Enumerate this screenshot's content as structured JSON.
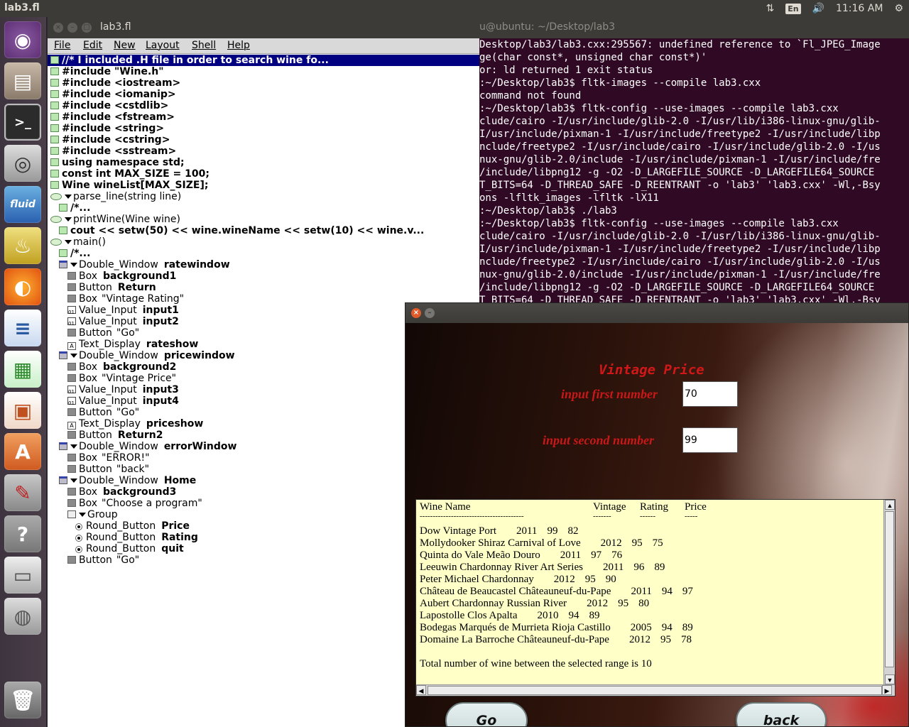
{
  "top_panel": {
    "title": "lab3.fl",
    "keyboard": "En",
    "time": "11:16 AM"
  },
  "launcher": {
    "items": [
      "ubuntu-dash",
      "files",
      "terminal",
      "camera",
      "fluid",
      "lamp",
      "firefox",
      "writer",
      "calc",
      "impress",
      "software-center",
      "settings",
      "help",
      "drive",
      "disk",
      "trash"
    ]
  },
  "fluid_window": {
    "title": "lab3.fl",
    "menu": [
      "File",
      "Edit",
      "New",
      "Layout",
      "Shell",
      "Help"
    ],
    "tree": [
      {
        "type": "code",
        "indent": 0,
        "text": "//* I included .H file in order to search wine fo...",
        "selected": true
      },
      {
        "type": "code",
        "indent": 0,
        "text": "#include \"Wine.h\""
      },
      {
        "type": "code",
        "indent": 0,
        "text": "#include <iostream>"
      },
      {
        "type": "code",
        "indent": 0,
        "text": "#include <iomanip>"
      },
      {
        "type": "code",
        "indent": 0,
        "text": "#include <cstdlib>"
      },
      {
        "type": "code",
        "indent": 0,
        "text": "#include <fstream>"
      },
      {
        "type": "code",
        "indent": 0,
        "text": "#include <string>"
      },
      {
        "type": "code",
        "indent": 0,
        "text": "#include <cstring>"
      },
      {
        "type": "code",
        "indent": 0,
        "text": "#include <sstream>"
      },
      {
        "type": "code",
        "indent": 0,
        "text": "using namespace std;"
      },
      {
        "type": "code",
        "indent": 0,
        "text": "const int MAX_SIZE = 100;"
      },
      {
        "type": "code",
        "indent": 0,
        "text": "Wine wineList[MAX_SIZE];"
      },
      {
        "type": "func",
        "indent": 0,
        "text": "parse_line(string line)"
      },
      {
        "type": "code",
        "indent": 1,
        "text": "/*..."
      },
      {
        "type": "func",
        "indent": 0,
        "text": "printWine(Wine wine)"
      },
      {
        "type": "code",
        "indent": 1,
        "text": "cout << setw(50) << wine.wineName << setw(10) << wine.v..."
      },
      {
        "type": "func",
        "indent": 0,
        "text": "main()"
      },
      {
        "type": "code",
        "indent": 1,
        "text": "/*..."
      },
      {
        "type": "win",
        "indent": 1,
        "kind": "Double_Window",
        "name": "ratewindow"
      },
      {
        "type": "box",
        "indent": 2,
        "kind": "Box",
        "name": "background1"
      },
      {
        "type": "box",
        "indent": 2,
        "kind": "Button",
        "name": "Return"
      },
      {
        "type": "box",
        "indent": 2,
        "kind": "Box",
        "label": "\"Vintage Rating\""
      },
      {
        "type": "inp",
        "indent": 2,
        "kind": "Value_Input",
        "name": "input1"
      },
      {
        "type": "inp",
        "indent": 2,
        "kind": "Value_Input",
        "name": "input2"
      },
      {
        "type": "box",
        "indent": 2,
        "kind": "Button",
        "label": "\"Go\""
      },
      {
        "type": "txt",
        "indent": 2,
        "kind": "Text_Display",
        "name": "rateshow"
      },
      {
        "type": "win",
        "indent": 1,
        "kind": "Double_Window",
        "name": "pricewindow"
      },
      {
        "type": "box",
        "indent": 2,
        "kind": "Box",
        "name": "background2"
      },
      {
        "type": "box",
        "indent": 2,
        "kind": "Box",
        "label": "\"Vintage Price\""
      },
      {
        "type": "inp",
        "indent": 2,
        "kind": "Value_Input",
        "name": "input3"
      },
      {
        "type": "inp",
        "indent": 2,
        "kind": "Value_Input",
        "name": "input4"
      },
      {
        "type": "box",
        "indent": 2,
        "kind": "Button",
        "label": "\"Go\""
      },
      {
        "type": "txt",
        "indent": 2,
        "kind": "Text_Display",
        "name": "priceshow"
      },
      {
        "type": "box",
        "indent": 2,
        "kind": "Button",
        "name": "Return2"
      },
      {
        "type": "win",
        "indent": 1,
        "kind": "Double_Window",
        "name": "errorWindow"
      },
      {
        "type": "box",
        "indent": 2,
        "kind": "Box",
        "label": "\"ERROR!\""
      },
      {
        "type": "box",
        "indent": 2,
        "kind": "Button",
        "label": "\"back\""
      },
      {
        "type": "win",
        "indent": 1,
        "kind": "Double_Window",
        "name": "Home"
      },
      {
        "type": "box",
        "indent": 2,
        "kind": "Box",
        "name": "background3"
      },
      {
        "type": "box",
        "indent": 2,
        "kind": "Box",
        "label": "\"Choose a program\""
      },
      {
        "type": "grp",
        "indent": 2,
        "kind": "Group"
      },
      {
        "type": "radio",
        "indent": 3,
        "kind": "Round_Button",
        "name": "Price"
      },
      {
        "type": "radio",
        "indent": 3,
        "kind": "Round_Button",
        "name": "Rating"
      },
      {
        "type": "radio",
        "indent": 3,
        "kind": "Round_Button",
        "name": "quit"
      },
      {
        "type": "box",
        "indent": 2,
        "kind": "Button",
        "label": "\"Go\""
      }
    ]
  },
  "terminal": {
    "title": "u@ubuntu: ~/Desktop/lab3",
    "lines": [
      "Desktop/lab3/lab3.cxx:295567: undefined reference to `Fl_JPEG_Image",
      "ge(char const*, unsigned char const*)'",
      "or: ld returned 1 exit status",
      ":~/Desktop/lab3$ fltk-images --compile lab3.cxx",
      "command not found",
      ":~/Desktop/lab3$ fltk-config --use-images --compile lab3.cxx",
      "clude/cairo -I/usr/include/glib-2.0 -I/usr/lib/i386-linux-gnu/glib-",
      "I/usr/include/pixman-1 -I/usr/include/freetype2 -I/usr/include/libp",
      "nclude/freetype2 -I/usr/include/cairo -I/usr/include/glib-2.0 -I/us",
      "nux-gnu/glib-2.0/include -I/usr/include/pixman-1 -I/usr/include/fre",
      "/include/libpng12 -g -O2 -D_LARGEFILE_SOURCE -D_LARGEFILE64_SOURCE",
      "T_BITS=64 -D_THREAD_SAFE -D_REENTRANT -o 'lab3' 'lab3.cxx' -Wl,-Bsy",
      "ons -lfltk_images -lfltk -lX11",
      ":~/Desktop/lab3$ ./lab3",
      ":~/Desktop/lab3$ fltk-config --use-images --compile lab3.cxx",
      "clude/cairo -I/usr/include/glib-2.0 -I/usr/lib/i386-linux-gnu/glib-",
      "I/usr/include/pixman-1 -I/usr/include/freetype2 -I/usr/include/libp",
      "nclude/freetype2 -I/usr/include/cairo -I/usr/include/glib-2.0 -I/us",
      "nux-gnu/glib-2.0/include -I/usr/include/pixman-1 -I/usr/include/fre",
      "/include/libpng12 -g -O2 -D_LARGEFILE_SOURCE -D_LARGEFILE64_SOURCE",
      "T_BITS=64 -D_THREAD_SAFE -D_REENTRANT -o 'lab3' 'lab3.cxx' -Wl,-Bsy"
    ]
  },
  "app_window": {
    "heading": "Vintage Price",
    "input1_label": "input first number",
    "input1_value": "70",
    "input2_label": "input second number",
    "input2_value": "99",
    "header": {
      "name": "Wine Name",
      "vintage": "Vintage",
      "rating": "Rating",
      "price": "Price"
    },
    "separator": {
      "name": "----------------------------------------",
      "vintage": "-------",
      "rating": "------",
      "price": "-----"
    },
    "wines": [
      {
        "name": "Dow Vintage Port",
        "vintage": "2011",
        "rating": "99",
        "price": "82"
      },
      {
        "name": "Mollydooker Shiraz Carnival of Love",
        "vintage": "2012",
        "rating": "95",
        "price": "75"
      },
      {
        "name": "Quinta do Vale Meão Douro",
        "vintage": "2011",
        "rating": "97",
        "price": "76"
      },
      {
        "name": "Leeuwin Chardonnay River Art Series",
        "vintage": "2011",
        "rating": "96",
        "price": "89"
      },
      {
        "name": "Peter Michael Chardonnay",
        "vintage": "2012",
        "rating": "95",
        "price": "90"
      },
      {
        "name": "Château de Beaucastel Châteauneuf-du-Pape",
        "vintage": "2011",
        "rating": "94",
        "price": "97"
      },
      {
        "name": "Aubert Chardonnay Russian River",
        "vintage": "2012",
        "rating": "95",
        "price": "80"
      },
      {
        "name": "Lapostolle Clos Apalta",
        "vintage": "2010",
        "rating": "94",
        "price": "89"
      },
      {
        "name": "Bodegas Marqués de Murrieta Rioja Castillo",
        "vintage": "2005",
        "rating": "94",
        "price": "89"
      },
      {
        "name": "Domaine La Barroche Châteauneuf-du-Pape",
        "vintage": "2012",
        "rating": "95",
        "price": "78"
      }
    ],
    "total_text": "Total number of wine between the selected range is 10",
    "go_label": "Go",
    "back_label": "back"
  }
}
